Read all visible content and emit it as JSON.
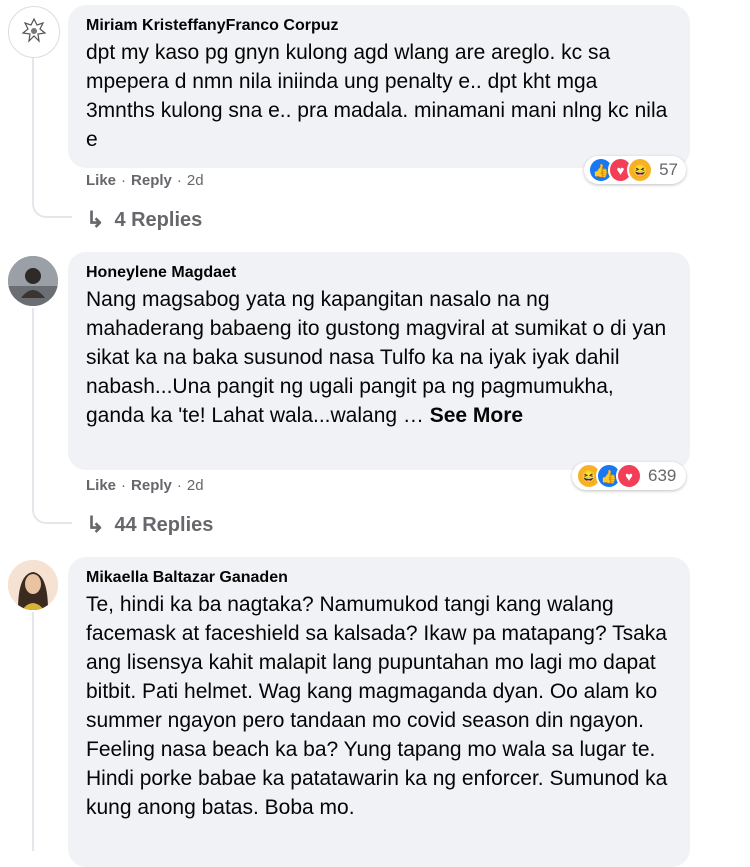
{
  "comments": [
    {
      "author": "Miriam KristeffanyFranco Corpuz",
      "text": "dpt my kaso pg gnyn kulong agd wlang are areglo. kc sa mpepera d nmn nila iniinda ung penalty e.. dpt kht mga 3mnths kulong sna e.. pra madala. minamani mani nlng kc nila e",
      "reaction_count": "57",
      "actions": {
        "like": "Like",
        "dot1": "·",
        "reply": "Reply",
        "dot2": "·",
        "time": "2d"
      },
      "replies_label": "4 Replies"
    },
    {
      "author": "Honeylene Magdaet",
      "text": "Nang magsabog yata ng kapangitan nasalo na ng mahaderang babaeng ito gustong magviral at sumikat o di yan sikat ka na baka susunod nasa Tulfo ka na iyak iyak dahil nabash...Una pangit ng ugali pangit pa ng pagmumukha, ganda ka 'te! Lahat wala...walang … ",
      "see_more": "See More",
      "reaction_count": "639",
      "actions": {
        "like": "Like",
        "dot1": "·",
        "reply": "Reply",
        "dot2": "·",
        "time": "2d"
      },
      "replies_label": "44 Replies"
    },
    {
      "author": "Mikaella Baltazar Ganaden",
      "text": "Te, hindi ka ba nagtaka? Namumukod tangi kang walang facemask at faceshield sa kalsada? Ikaw pa matapang? Tsaka ang lisensya kahit malapit lang pupuntahan mo lagi mo dapat bitbit. Pati helmet. Wag kang magmaganda dyan. Oo alam ko summer ngayon pero tandaan mo covid season din ngayon. Feeling nasa beach ka ba? Yung tapang mo wala sa lugar te. Hindi porke babae ka patatawarin ka ng enforcer. Sumunod ka kung anong batas. Boba mo."
    }
  ],
  "icons": {
    "reply_arrow": "↳",
    "like": "👍",
    "love": "♥",
    "haha": "😆"
  }
}
